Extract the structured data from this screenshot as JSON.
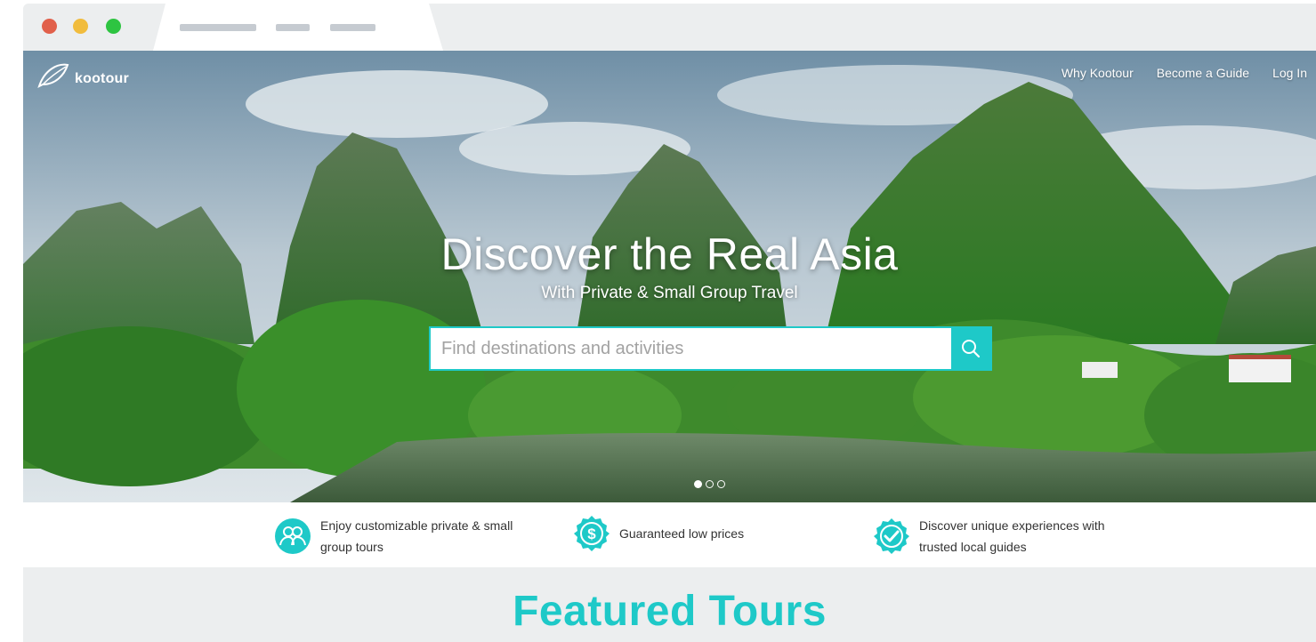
{
  "brand": {
    "logo_text": "kootour"
  },
  "nav": {
    "items": [
      {
        "label": "Why Kootour"
      },
      {
        "label": "Become a Guide"
      },
      {
        "label": "Log In"
      }
    ]
  },
  "hero": {
    "headline": "Discover the Real Asia",
    "subline": "With Private & Small Group Travel",
    "search_placeholder": "Find destinations and activities",
    "carousel": {
      "total": 3,
      "active_index": 0
    }
  },
  "features": [
    {
      "icon": "group-icon",
      "text_line1": "Enjoy customizable private & small",
      "text_line2": "group tours"
    },
    {
      "icon": "dollar-badge-icon",
      "text_line1": "Guaranteed low prices",
      "text_line2": ""
    },
    {
      "icon": "check-badge-icon",
      "text_line1": "Discover unique experiences with",
      "text_line2": "trusted local guides"
    }
  ],
  "featured": {
    "title": "Featured Tours"
  },
  "colors": {
    "accent": "#1ec9c8",
    "chrome_bg": "#eceeef",
    "dot_red": "#e1604b",
    "dot_yellow": "#f1bc3d",
    "dot_green": "#2ec441"
  }
}
